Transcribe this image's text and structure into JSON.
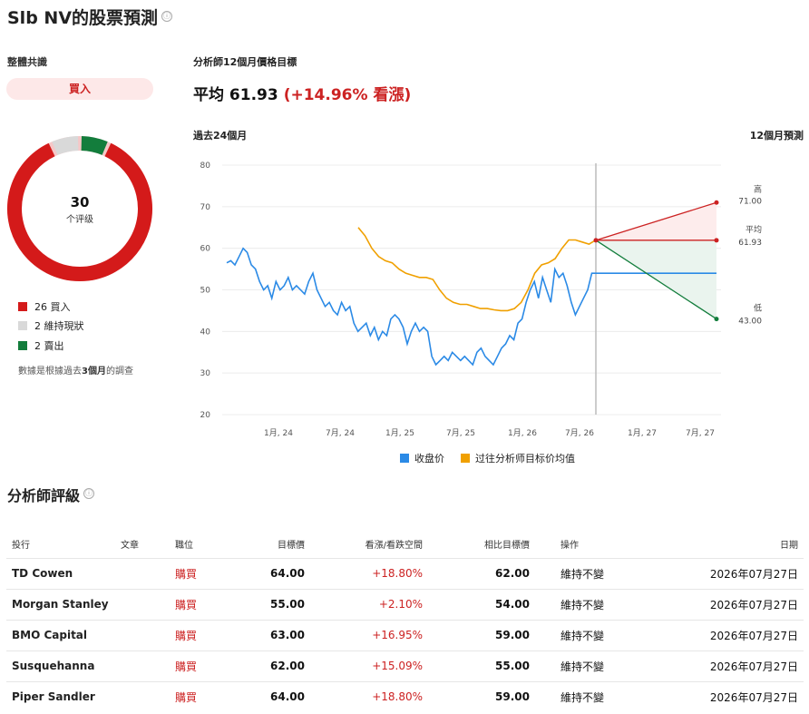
{
  "header": {
    "title": "Slb NV的股票預測",
    "info_icon": "ⓘ"
  },
  "consensus": {
    "label": "整體共識",
    "rating": "買入",
    "total": "30",
    "unit": "个评级",
    "legend": [
      {
        "text": "26 買入",
        "color": "#d41a1a"
      },
      {
        "text": "2 維持現狀",
        "color": "#d9d9d9"
      },
      {
        "text": "2 賣出",
        "color": "#137d3c"
      }
    ],
    "note_prefix": "數據是根據過去",
    "note_bold": "3個月",
    "note_suffix": "的調查"
  },
  "target": {
    "label": "分析師12個月價格目標",
    "avg_prefix": "平均 61.93",
    "avg_change": "(+14.96% 看漲)"
  },
  "chart_data": {
    "type": "line",
    "past_label": "過去24個月",
    "forecast_label": "12個月預測",
    "ylim": [
      20,
      80
    ],
    "yticks": [
      "80",
      "70",
      "60",
      "50",
      "40",
      "30",
      "20"
    ],
    "xticks": [
      "1月, 24",
      "7月, 24",
      "1月, 25",
      "7月, 25",
      "1月, 26",
      "7月, 26",
      "1月, 27",
      "7月, 27"
    ],
    "series": [
      {
        "name": "收盘价",
        "color": "#2b8ae6",
        "values": [
          56.5,
          57,
          56,
          58,
          60,
          59,
          56,
          55,
          52,
          50,
          51,
          48,
          52,
          50,
          51,
          53,
          50,
          51,
          50,
          49,
          52,
          54,
          50,
          48,
          46,
          47,
          45,
          44,
          47,
          45,
          46,
          42,
          40,
          41,
          42,
          39,
          41,
          38,
          40,
          39,
          43,
          44,
          43,
          41,
          37,
          40,
          42,
          40,
          41,
          40,
          34,
          32,
          33,
          34,
          33,
          35,
          34,
          33,
          34,
          33,
          32,
          35,
          36,
          34,
          33,
          32,
          34,
          36,
          37,
          39,
          38,
          42,
          43,
          47,
          50,
          52,
          48,
          53,
          50,
          47,
          55,
          53,
          54,
          51,
          47,
          44,
          46,
          48,
          50,
          54,
          54
        ]
      },
      {
        "name": "过往分析师目标价均值",
        "color": "#f0a000",
        "values": [
          65,
          63,
          60,
          58,
          57,
          56.5,
          55,
          54,
          53.5,
          53,
          53,
          52.5,
          50,
          48,
          47,
          46.5,
          46.5,
          46,
          45.5,
          45.5,
          45.2,
          45,
          45,
          45.5,
          47,
          50,
          54,
          56,
          56.5,
          57.5,
          60,
          62,
          62,
          61.5,
          61,
          62
        ]
      }
    ],
    "forecast": {
      "high_label": "高",
      "high": "71.00",
      "avg_label": "平均",
      "avg": "61.93",
      "low_label": "低",
      "low": "43.00",
      "current": 54
    }
  },
  "ratings": {
    "title": "分析師評級",
    "columns": [
      "投行",
      "文章",
      "職位",
      "目標價",
      "看漲/看跌空間",
      "相比目標價",
      "操作",
      "日期"
    ],
    "rows": [
      {
        "firm": "TD Cowen",
        "position": "購買",
        "target": "64.00",
        "upside": "+18.80%",
        "prev": "62.00",
        "action": "維持不變",
        "date": "2026年07月27日"
      },
      {
        "firm": "Morgan Stanley",
        "position": "購買",
        "target": "55.00",
        "upside": "+2.10%",
        "prev": "54.00",
        "action": "維持不變",
        "date": "2026年07月27日"
      },
      {
        "firm": "BMO Capital",
        "position": "購買",
        "target": "63.00",
        "upside": "+16.95%",
        "prev": "59.00",
        "action": "維持不變",
        "date": "2026年07月27日"
      },
      {
        "firm": "Susquehanna",
        "position": "購買",
        "target": "62.00",
        "upside": "+15.09%",
        "prev": "55.00",
        "action": "維持不變",
        "date": "2026年07月27日"
      },
      {
        "firm": "Piper Sandler",
        "position": "購買",
        "target": "64.00",
        "upside": "+18.80%",
        "prev": "59.00",
        "action": "維持不變",
        "date": "2026年07月27日"
      }
    ]
  }
}
